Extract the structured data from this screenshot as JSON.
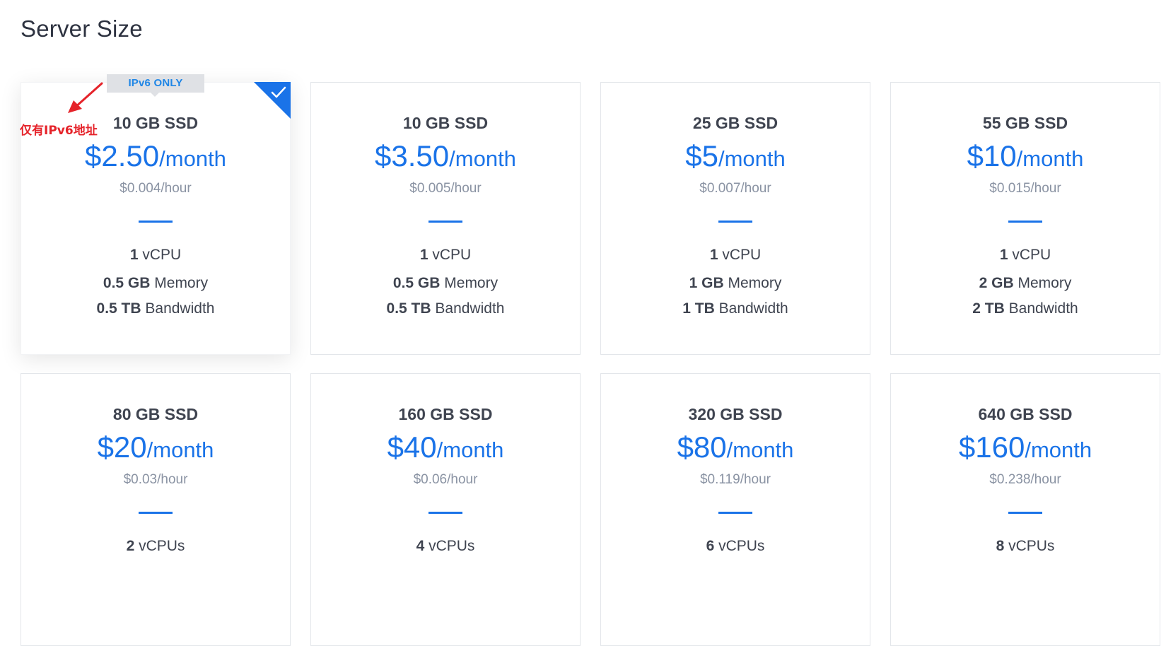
{
  "page": {
    "title": "Server Size"
  },
  "annotation": {
    "text": "仅有IPv6地址"
  },
  "plans": [
    {
      "disk": "10 GB SSD",
      "amount": "$2.50",
      "unit": "/month",
      "hourly": "$0.004/hour",
      "cpu_num": "1",
      "cpu_label": "vCPU",
      "mem_num": "0.5 GB",
      "mem_label": "Memory",
      "bw_num": "0.5 TB",
      "bw_label": "Bandwidth",
      "badge": "IPv6 ONLY",
      "selected": true
    },
    {
      "disk": "10 GB SSD",
      "amount": "$3.50",
      "unit": "/month",
      "hourly": "$0.005/hour",
      "cpu_num": "1",
      "cpu_label": "vCPU",
      "mem_num": "0.5 GB",
      "mem_label": "Memory",
      "bw_num": "0.5 TB",
      "bw_label": "Bandwidth"
    },
    {
      "disk": "25 GB SSD",
      "amount": "$5",
      "unit": "/month",
      "hourly": "$0.007/hour",
      "cpu_num": "1",
      "cpu_label": "vCPU",
      "mem_num": "1 GB",
      "mem_label": "Memory",
      "bw_num": "1 TB",
      "bw_label": "Bandwidth"
    },
    {
      "disk": "55 GB SSD",
      "amount": "$10",
      "unit": "/month",
      "hourly": "$0.015/hour",
      "cpu_num": "1",
      "cpu_label": "vCPU",
      "mem_num": "2 GB",
      "mem_label": "Memory",
      "bw_num": "2 TB",
      "bw_label": "Bandwidth"
    },
    {
      "disk": "80 GB SSD",
      "amount": "$20",
      "unit": "/month",
      "hourly": "$0.03/hour",
      "cpu_num": "2",
      "cpu_label": "vCPUs"
    },
    {
      "disk": "160 GB SSD",
      "amount": "$40",
      "unit": "/month",
      "hourly": "$0.06/hour",
      "cpu_num": "4",
      "cpu_label": "vCPUs"
    },
    {
      "disk": "320 GB SSD",
      "amount": "$80",
      "unit": "/month",
      "hourly": "$0.119/hour",
      "cpu_num": "6",
      "cpu_label": "vCPUs"
    },
    {
      "disk": "640 GB SSD",
      "amount": "$160",
      "unit": "/month",
      "hourly": "$0.238/hour",
      "cpu_num": "8",
      "cpu_label": "vCPUs"
    }
  ],
  "colors": {
    "accent": "#1a73e8",
    "muted": "#8a93a3",
    "annotation": "#e5232a"
  }
}
